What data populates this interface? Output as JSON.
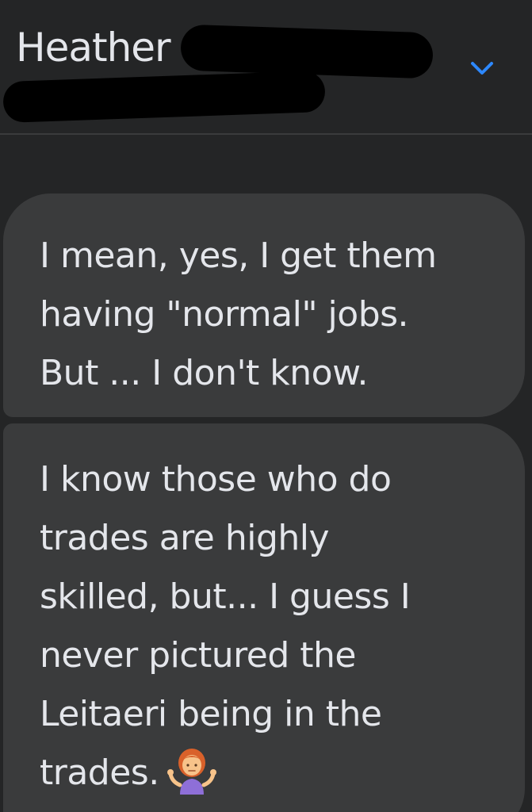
{
  "header": {
    "contact_name": "Heather"
  },
  "icons": {
    "collapse": "chevron-down-icon",
    "emoji": "woman-shrugging-emoji"
  },
  "colors": {
    "background": "#242526",
    "bubble": "#3a3b3c",
    "text": "#e4e6eb",
    "accent": "#2d88ff"
  },
  "messages": [
    {
      "lines": [
        "I mean, yes, I get them",
        "having \"normal\" jobs.",
        "But ... I don't know."
      ]
    },
    {
      "lines": [
        "I know those who do",
        "trades are highly",
        "skilled, but... I guess I",
        "never pictured the",
        "Leitaeri being in the",
        "trades."
      ]
    }
  ]
}
